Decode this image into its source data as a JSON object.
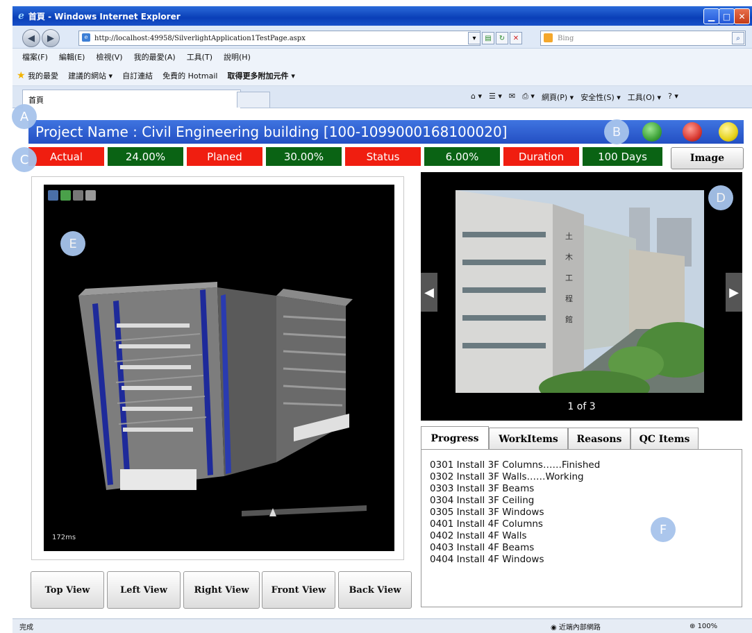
{
  "window": {
    "title": "首頁 - Windows Internet Explorer",
    "url": "http://localhost:49958/SilverlightApplication1TestPage.aspx",
    "search_placeholder": "Bing",
    "tab_title": "首頁"
  },
  "menu": [
    "檔案(F)",
    "編輯(E)",
    "檢視(V)",
    "我的最愛(A)",
    "工具(T)",
    "說明(H)"
  ],
  "favorites": [
    "我的最愛",
    "建議的網站 ▾",
    "自訂連結",
    "免費的 Hotmail",
    "取得更多附加元件 ▾"
  ],
  "command_bar": [
    "網頁(P) ▾",
    "安全性(S) ▾",
    "工具(O) ▾"
  ],
  "project": {
    "title": "Project Name : Civil Engineering building [100-1099000168100020]"
  },
  "status_lights": {
    "colors": [
      "#3fa33a",
      "#d83a32",
      "#e6d21c"
    ]
  },
  "stats": {
    "actual_label": "Actual",
    "actual_value": "24.00%",
    "planed_label": "Planed",
    "planed_value": "30.00%",
    "status_label": "Status",
    "status_value": "6.00%",
    "duration_label": "Duration",
    "duration_value": "100 Days",
    "image_button": "Image"
  },
  "markers": {
    "a": "A",
    "b": "B",
    "c": "C",
    "d": "D",
    "e": "E",
    "f": "F"
  },
  "viewer": {
    "render_time": "172ms",
    "tool_icons": [
      "refresh-icon",
      "help-icon",
      "wrench-icon",
      "page-icon"
    ]
  },
  "view_buttons": {
    "top": "Top View",
    "left": "Left View",
    "right": "Right View",
    "front": "Front View",
    "back": "Back View"
  },
  "gallery": {
    "counter": "1 of 3",
    "sign_text": "土木工程館"
  },
  "tabs": {
    "progress": "Progress",
    "workitems": "WorkItems",
    "reasons": "Reasons",
    "qc": "QC Items"
  },
  "progress_items": [
    "0301 Install 3F Columns……Finished",
    "0302 Install 3F Walls……Working",
    "0303 Install 3F Beams",
    "0304 Install 3F Ceiling",
    "0305 Install 3F Windows",
    "0401 Install 4F Columns",
    "0402 Install 4F Walls",
    "0403 Install 4F Beams",
    "0404 Install 4F Windows"
  ],
  "statusbar": {
    "left": "完成",
    "zone": "近端內部網路",
    "zoom": "100%"
  },
  "colors": {
    "red": "#f01e10",
    "green": "#0a6314",
    "title_blue": "#2f5fd6"
  }
}
